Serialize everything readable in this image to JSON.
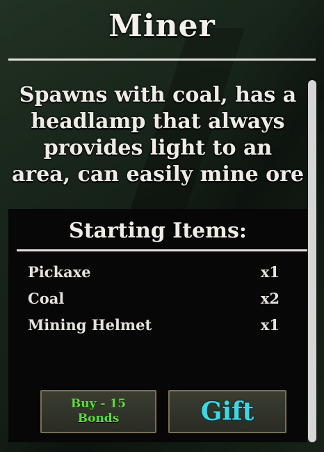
{
  "class_title": "Miner",
  "description_lines": [
    "Spawns with coal, has a",
    "headlamp that always",
    "provides light to an",
    "area, can easily mine ore"
  ],
  "starting_items": {
    "heading": "Starting Items:",
    "items": [
      {
        "name": "Pickaxe",
        "qty": "x1"
      },
      {
        "name": "Coal",
        "qty": "x2"
      },
      {
        "name": "Mining Helmet",
        "qty": "x1"
      }
    ]
  },
  "buttons": {
    "buy_label": "Buy - 15\nBonds",
    "gift_label": "Gift"
  },
  "colors": {
    "buy_text": "#5fdc3a",
    "gift_text": "#3bd8e4"
  }
}
